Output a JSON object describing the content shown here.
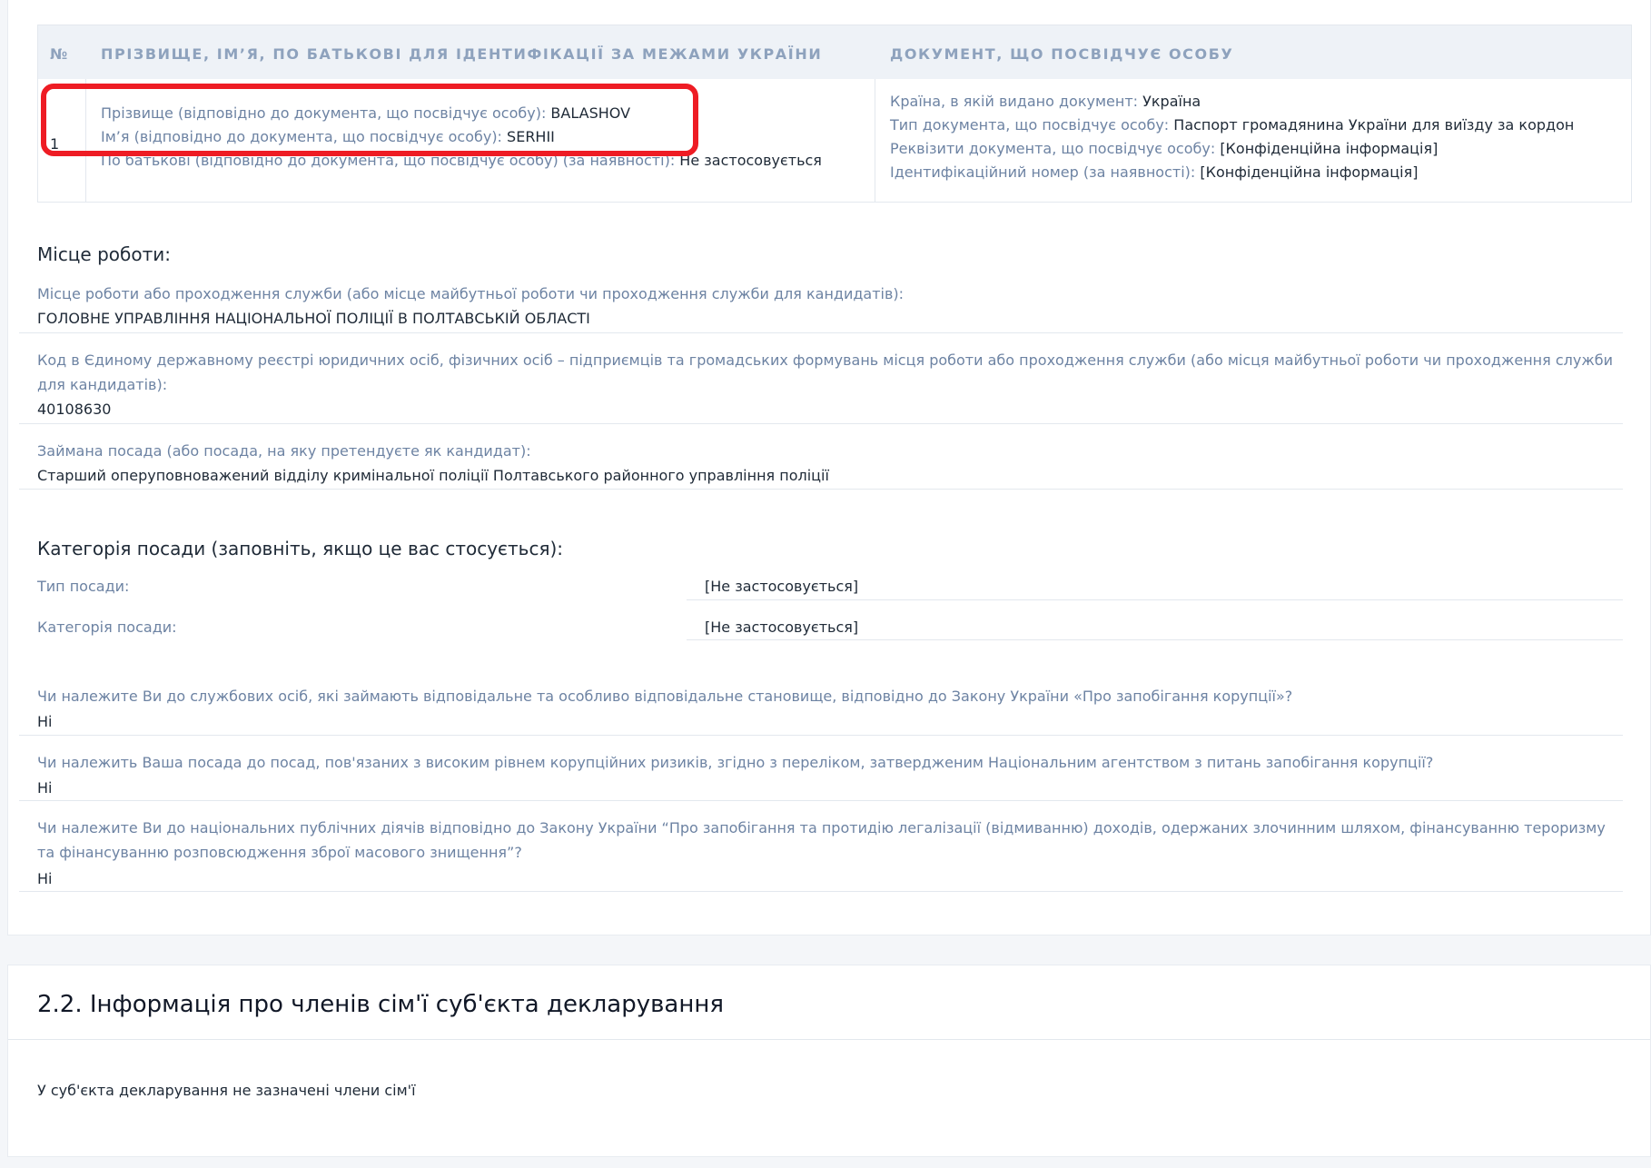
{
  "identification_table": {
    "headers": {
      "num": "№",
      "name": "Прізвище, ім’я, по батькові для ідентифікації за межами України",
      "document": "Документ, що посвідчує особу"
    },
    "row": {
      "num": "1",
      "surname_label": "Прізвище (відповідно до документа, що посвідчує особу):",
      "surname_value": "BALASHOV",
      "name_label": "Ім’я (відповідно до документа, що посвідчує особу):",
      "name_value": "SERHII",
      "patronymic_label": "По батькові (відповідно до документа, що посвідчує особу) (за наявності):",
      "patronymic_value": "Не застосовується",
      "country_label": "Країна, в якій видано документ:",
      "country_value": "Україна",
      "doctype_label": "Тип документа, що посвідчує особу:",
      "doctype_value": "Паспорт громадянина України для виїзду за кордон",
      "requisites_label": "Реквізити документа, що посвідчує особу:",
      "requisites_value": "[Конфіденційна інформація]",
      "idnum_label": "Ідентифікаційний номер (за наявності):",
      "idnum_value": "[Конфіденційна інформація]"
    },
    "highlight_color": "#ee1c24"
  },
  "workplace": {
    "title": "Місце роботи:",
    "place_label": "Місце роботи або проходження служби (або місце майбутньої роботи чи проходження служби для кандидатів):",
    "place_value": "ГОЛОВНЕ УПРАВЛІННЯ НАЦІОНАЛЬНОЇ ПОЛІЦІЇ В ПОЛТАВСЬКІЙ ОБЛАСТІ",
    "code_label": "Код в Єдиному державному реєстрі юридичних осіб, фізичних осіб – підприємців та громадських формувань місця роботи або проходження служби (або місця майбутньої роботи чи проходження служби для кандидатів):",
    "code_value": "40108630",
    "position_label": "Займана посада (або посада, на яку претендуєте як кандидат):",
    "position_value": "Старший оперуповноважений відділу кримінальної поліції Полтавського районного управління поліції"
  },
  "position_category": {
    "title": "Категорія посади (заповніть, якщо це вас стосується):",
    "type_label": "Тип посади:",
    "type_value": "[Не застосовується]",
    "category_label": "Категорія посади:",
    "category_value": "[Не застосовується]"
  },
  "questions": [
    {
      "question": "Чи належите Ви до службових осіб, які займають відповідальне та особливо відповідальне становище, відповідно до Закону України «Про запобігання корупції»?",
      "answer": "Ні"
    },
    {
      "question": "Чи належить Ваша посада до посад, пов'язаних з високим рівнем корупційних ризиків, згідно з переліком, затвердженим Національним агентством з питань запобігання корупції?",
      "answer": "Ні"
    },
    {
      "question": "Чи належите Ви до національних публічних діячів відповідно до Закону України “Про запобігання та протидію легалізації (відмиванню) доходів, одержаних злочинним шляхом, фінансуванню тероризму та фінансуванню розповсюдження зброї масового знищення”?",
      "answer": "Ні"
    }
  ],
  "family_section": {
    "title": "2.2. Інформація про членів сім'ї суб'єкта декларування",
    "empty_text": "У суб'єкта декларування не зазначені члени сім'ї"
  }
}
